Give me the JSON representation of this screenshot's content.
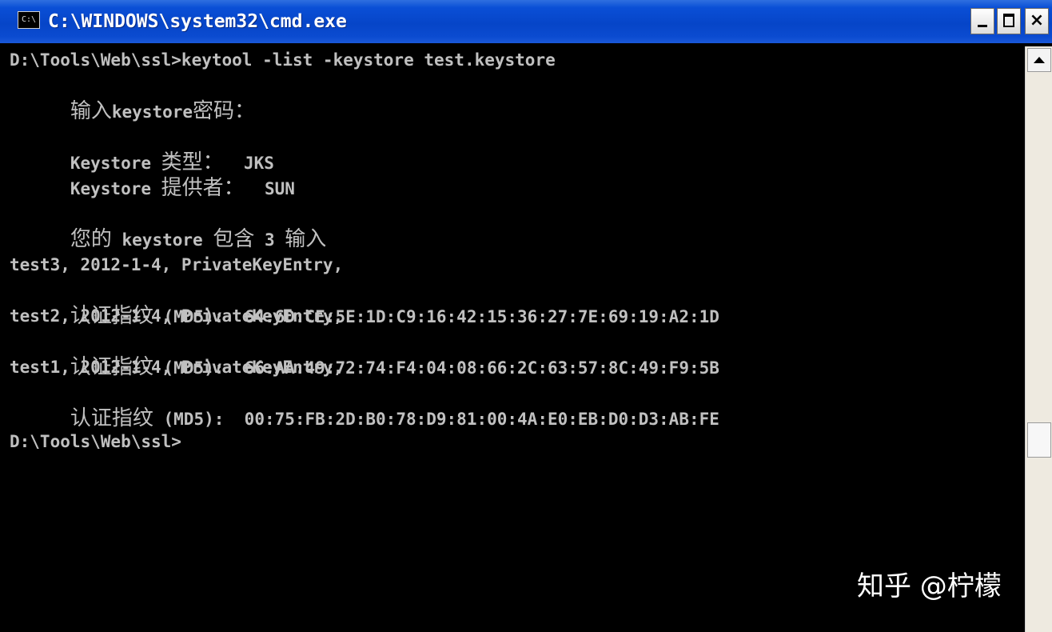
{
  "window": {
    "title": "C:\\WINDOWS\\system32\\cmd.exe",
    "icon_label": "C:\\",
    "buttons": {
      "minimize": "minimize",
      "maximize": "maximize",
      "close": "×"
    }
  },
  "console": {
    "lines": [
      {
        "type": "cmd",
        "text": "D:\\Tools\\Web\\ssl>keytool -list -keystore test.keystore"
      },
      {
        "type": "prompt",
        "prefix": "输入",
        "rest": "keystore",
        "suffix": "密码："
      },
      {
        "type": "blank"
      },
      {
        "type": "info",
        "label": "Keystore ",
        "zh": "类型：",
        "value": "  JKS"
      },
      {
        "type": "info",
        "label": "Keystore ",
        "zh": "提供者：",
        "value": "  SUN"
      },
      {
        "type": "blank"
      },
      {
        "type": "mixed",
        "zh1": "您的",
        "mid1": " keystore ",
        "zh2": "包含",
        "mid2": " 3 ",
        "zh3": "输入"
      },
      {
        "type": "blank"
      },
      {
        "type": "entry",
        "text": "test3, 2012-1-4, PrivateKeyEntry,"
      },
      {
        "type": "fp",
        "zh": "认证指纹",
        "label": " (MD5):  ",
        "value": "64:6D:CE:5E:1D:C9:16:42:15:36:27:7E:69:19:A2:1D"
      },
      {
        "type": "entry",
        "text": "test2, 2012-1-4, PrivateKeyEntry,"
      },
      {
        "type": "fp",
        "zh": "认证指纹",
        "label": " (MD5):  ",
        "value": "66:AA:49:72:74:F4:04:08:66:2C:63:57:8C:49:F9:5B"
      },
      {
        "type": "entry",
        "text": "test1, 2012-1-4, PrivateKeyEntry,"
      },
      {
        "type": "fp",
        "zh": "认证指纹",
        "label": " (MD5):  ",
        "value": "00:75:FB:2D:B0:78:D9:81:00:4A:E0:EB:D0:D3:AB:FE"
      },
      {
        "type": "blank"
      },
      {
        "type": "cmd",
        "text": "D:\\Tools\\Web\\ssl>"
      }
    ]
  },
  "watermark": {
    "text": "知乎 @柠檬"
  },
  "colors": {
    "console_bg": "#000000",
    "console_text": "#c0c0c0",
    "titlebar": "#0645c8",
    "title_text": "#ffffff"
  }
}
